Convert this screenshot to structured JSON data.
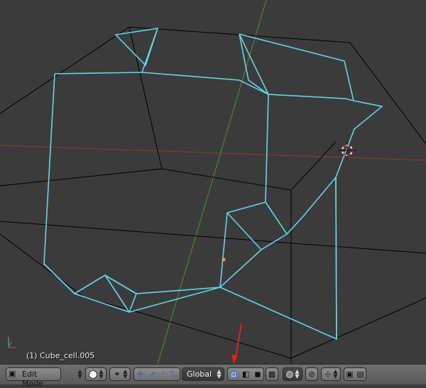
{
  "viewport": {
    "object_info": "(1) Cube_cell.005",
    "colors": {
      "background": "#3b3b3b",
      "wire": "#000000",
      "selected_edges": "#5fd8e6",
      "x_axis": "#8a3d3d",
      "y_axis": "#4f8f2f",
      "cursor": "#d02020",
      "origin": "#f0a040",
      "annotation_arrow": "#e8200c"
    }
  },
  "header": {
    "editor_type_icon": "3d-view-icon",
    "mode_select": "Edit Mode",
    "shading_icon": "solid-shading-icon",
    "pivot_icon": "pivot-point-icon",
    "transform_orientation": "Global",
    "select_mode_icons": [
      "vertex-select-icon",
      "edge-select-icon",
      "face-select-icon"
    ],
    "occlude_icon": "limit-selection-icon",
    "proportional_icon": "proportional-editing-icon",
    "snap_icon": "magnet-icon",
    "snap_element_icon": "snap-increment-icon",
    "render_icon": "opengl-render-icon",
    "anim_render_icon": "opengl-anim-icon"
  }
}
